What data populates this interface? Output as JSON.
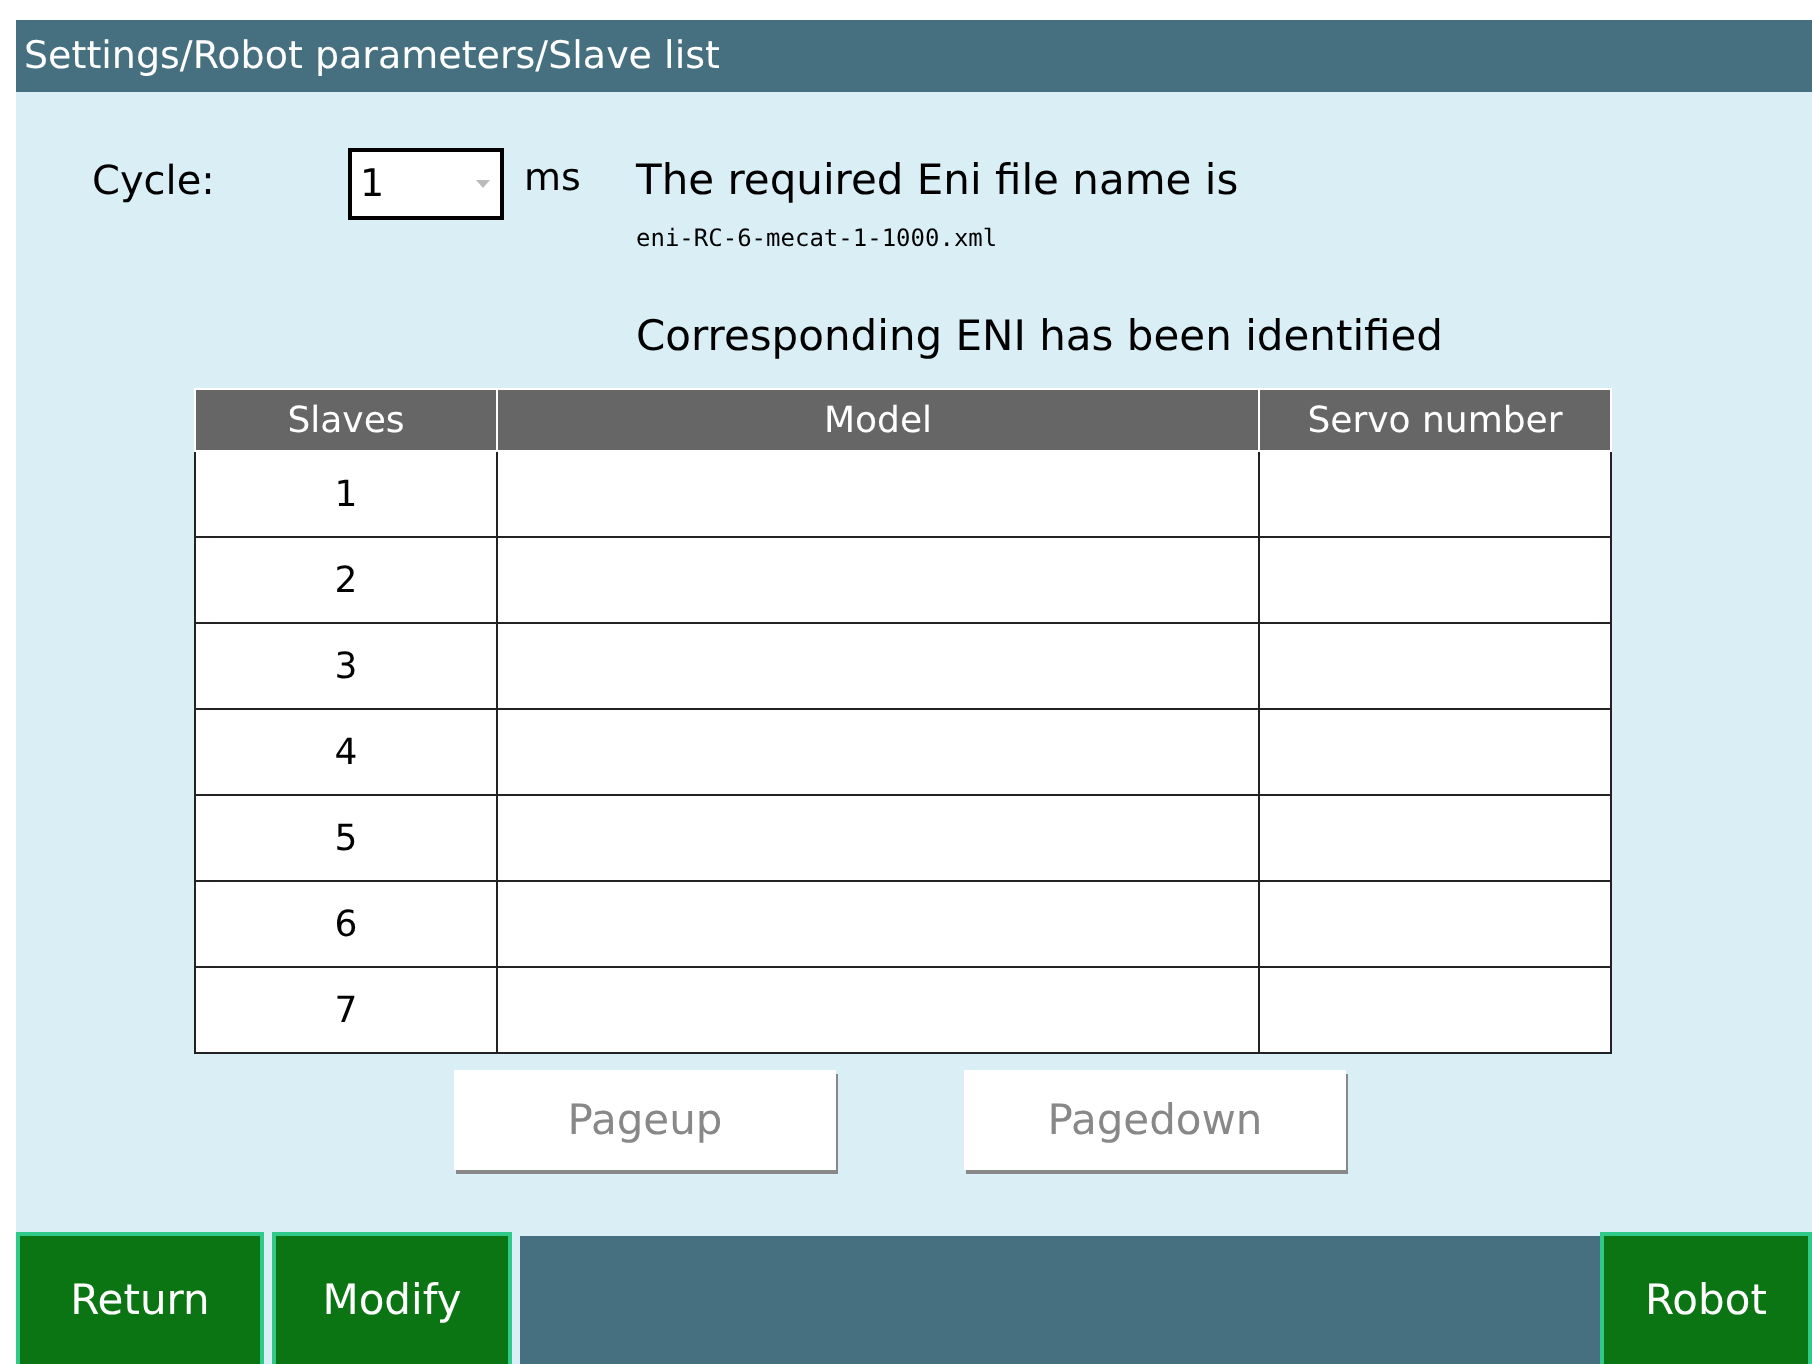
{
  "window": {
    "title": "Settings/Robot parameters/Slave list"
  },
  "cycle": {
    "label": "Cycle:",
    "value": "1",
    "unit": "ms"
  },
  "eni": {
    "prompt": "The required Eni file name is",
    "filename": "eni-RC-6-mecat-1-1000.xml",
    "status": "Corresponding ENI  has been identified"
  },
  "table": {
    "columns": [
      "Slaves",
      "Model",
      "Servo number"
    ],
    "rows": [
      [
        "1",
        "",
        ""
      ],
      [
        "2",
        "",
        ""
      ],
      [
        "3",
        "",
        ""
      ],
      [
        "4",
        "",
        ""
      ],
      [
        "5",
        "",
        ""
      ],
      [
        "6",
        "",
        ""
      ],
      [
        "7",
        "",
        ""
      ]
    ]
  },
  "pager": [
    {
      "label": "Pageup",
      "disabled": true
    },
    {
      "label": "Pagedown",
      "disabled": true
    }
  ],
  "footer": {
    "left": [
      "Return",
      "Modify"
    ],
    "right": [
      "Robot"
    ]
  }
}
